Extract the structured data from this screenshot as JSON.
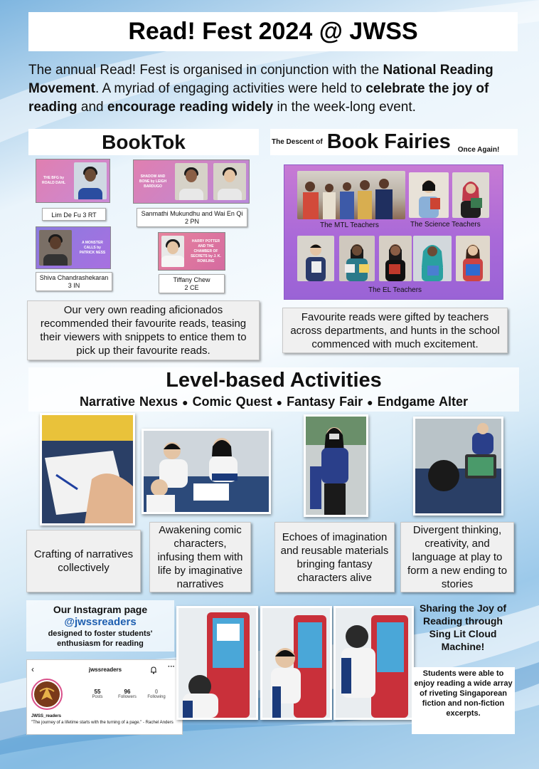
{
  "title": "Read! Fest 2024 @ JWSS",
  "intro": {
    "p1": "The annual Read! Fest is organised in conjunction with the ",
    "b1": "National Reading Movement",
    "p2": ". A myriad of engaging activities were held to ",
    "b2": "celebrate the joy of reading",
    "p3": " and ",
    "b3": "encourage reading widely",
    "p4": " in the week-long event."
  },
  "booktok": {
    "heading": "BookTok",
    "entries": [
      {
        "book": "THE BFG by ROALD DAHL",
        "caption": "Lim De Fu 3 RT"
      },
      {
        "book": "SHADOW AND BONE by LEIGH BARDUGO",
        "caption_l1": "Sanmathi Mukundhu and Wai En Qi",
        "caption_l2": "2 PN"
      },
      {
        "book": "A MONSTER CALLS by PATRICK NESS",
        "caption_l1": "Shiva Chandrashekaran",
        "caption_l2": "3 IN"
      },
      {
        "book": "HARRY POTTER AND THE CHAMBER OF SECRETS by J. K. ROWLING",
        "caption_l1": "Tiffany Chew",
        "caption_l2": "2 CE"
      }
    ],
    "description": "Our very own reading aficionados recommended their favourite reads, teasing their viewers with snippets to entice them to pick up their favourite reads."
  },
  "fairies": {
    "prefix": "The Descent of",
    "heading": "Book Fairies",
    "suffix": "Once Again!",
    "labels": {
      "mtl": "The MTL Teachers",
      "science": "The Science Teachers",
      "el": "The EL Teachers"
    },
    "description": "Favourite reads were gifted by teachers across departments, and hunts in the school commenced with much excitement."
  },
  "level": {
    "heading": "Level-based Activities",
    "activities": [
      "Narrative Nexus",
      "Comic Quest",
      "Fantasy Fair",
      "Endgame Alter"
    ],
    "bullet": "●",
    "captions": [
      "Crafting of narratives collectively",
      "Awakening comic characters, infusing them with life by imaginative narratives",
      "Echoes of imagination and reusable materials bringing fantasy characters alive",
      "Divergent thinking, creativity, and language at play to form a new ending to stories"
    ]
  },
  "instagram": {
    "title": "Our Instagram page",
    "handle": "@jwssreaders",
    "desc": "designed to foster students' enthusiasm for reading",
    "profile": {
      "username": "jwssreaders",
      "posts": "55",
      "posts_label": "Posts",
      "followers": "96",
      "followers_label": "Followers",
      "following": "0",
      "following_label": "Following",
      "name": "JWSS_readers",
      "bio": "\"The journey of a lifetime starts with the turning of a page.\" - Rachel Anders",
      "back_icon": "back-icon",
      "bell_icon": "bell-icon",
      "more_icon": "more-icon"
    }
  },
  "singlit": {
    "heading": "Sharing the Joy of Reading through Sing Lit Cloud Machine!",
    "desc": "Students were able to enjoy reading a wide array of riveting Singaporean fiction and non-fiction excerpts."
  },
  "colors": {
    "handle": "#1f5fb0",
    "fairies_panel": "#a969d8",
    "booktok_thumb": "#c98ad6"
  }
}
